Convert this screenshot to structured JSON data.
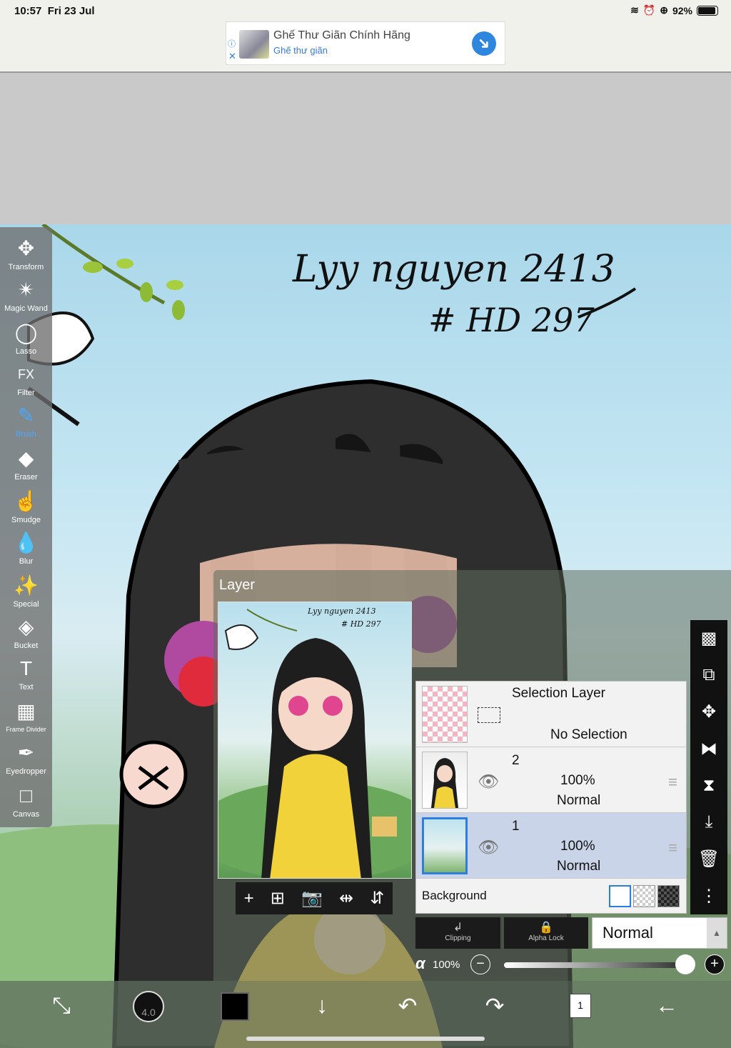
{
  "status_bar": {
    "time": "10:57",
    "date": "Fri 23 Jul",
    "battery": "92%"
  },
  "ad": {
    "title": "Ghế Thư Giãn Chính Hãng",
    "subtitle": "Ghế thư giãn"
  },
  "canvas": {
    "signature_line1": "Lyy nguyen 2413",
    "signature_line2": "# HD 297"
  },
  "tools": [
    {
      "label": "Transform",
      "icon": "✥"
    },
    {
      "label": "Magic Wand",
      "icon": "✴"
    },
    {
      "label": "Lasso",
      "icon": "◯"
    },
    {
      "label": "Filter",
      "icon": "FX"
    },
    {
      "label": "Brush",
      "icon": "✎"
    },
    {
      "label": "Eraser",
      "icon": "◆"
    },
    {
      "label": "Smudge",
      "icon": "☝"
    },
    {
      "label": "Blur",
      "icon": "💧"
    },
    {
      "label": "Special",
      "icon": "✨"
    },
    {
      "label": "Bucket",
      "icon": "◈"
    },
    {
      "label": "Text",
      "icon": "T"
    },
    {
      "label": "Frame Divider",
      "icon": "▦"
    },
    {
      "label": "Eyedropper",
      "icon": "✒"
    },
    {
      "label": "Canvas",
      "icon": "□"
    }
  ],
  "layer_panel": {
    "title": "Layer",
    "selection_layer": {
      "name": "Selection Layer",
      "status": "No Selection"
    },
    "layers": [
      {
        "number": "2",
        "opacity": "100%",
        "mode": "Normal"
      },
      {
        "number": "1",
        "opacity": "100%",
        "mode": "Normal"
      }
    ],
    "background_label": "Background",
    "clipping_label": "Clipping",
    "alpha_lock_label": "Alpha Lock",
    "blend_mode": "Normal",
    "alpha_symbol": "α",
    "alpha_value": "100%",
    "alpha_level": 1.0,
    "preview_signature_line1": "Lyy nguyen 2413",
    "preview_signature_line2": "# HD 297"
  },
  "bottom_bar": {
    "brush_size": "4.0",
    "layer_count": "1"
  },
  "colors": {
    "accent": "#2e7de0",
    "active_tool": "#4aa8ff",
    "primary_color": "#000000"
  }
}
